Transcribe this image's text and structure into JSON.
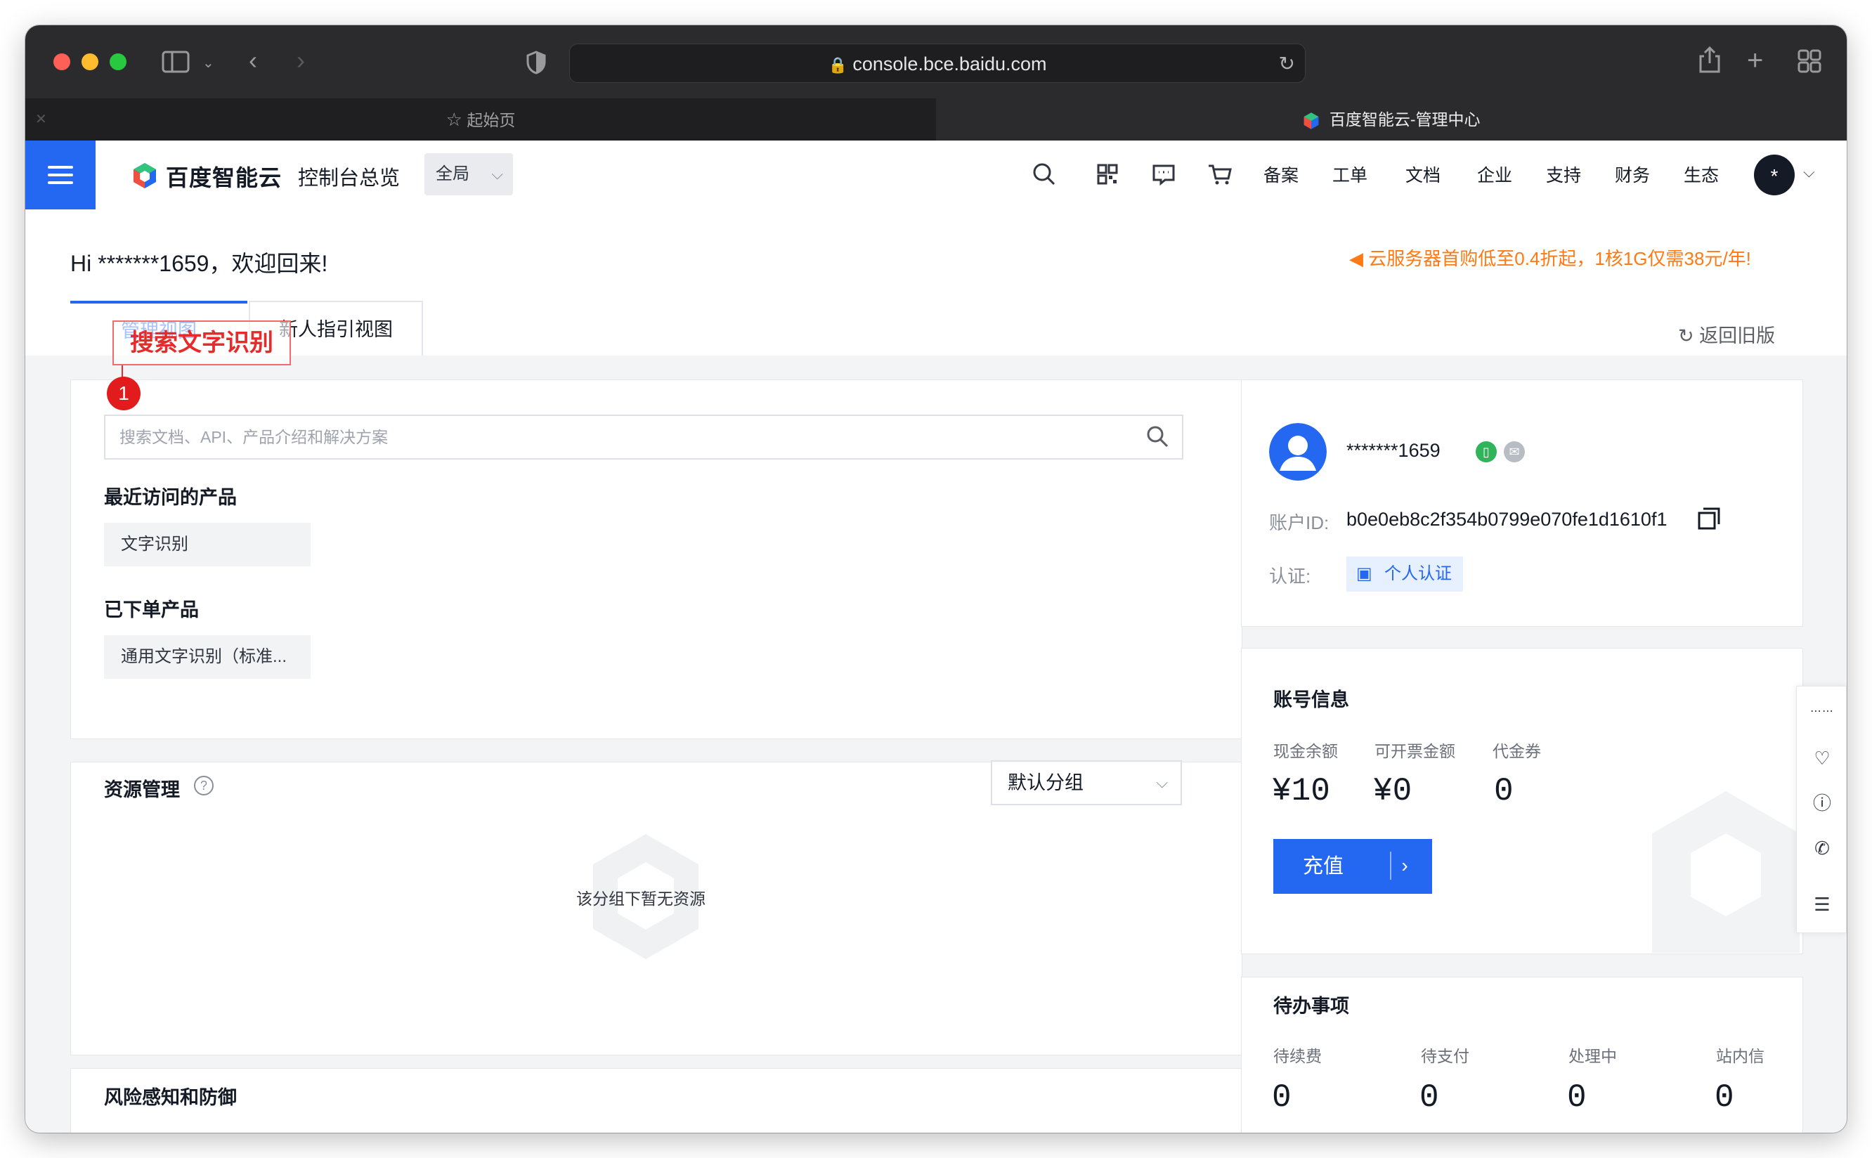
{
  "browser": {
    "url": "console.bce.baidu.com",
    "tabs": [
      {
        "label": "起始页"
      },
      {
        "label": "百度智能云-管理中心"
      }
    ]
  },
  "header": {
    "logo_text": "百度智能云",
    "console_title": "控制台总览",
    "region": "全局",
    "nav": [
      "备案",
      "工单",
      "文档",
      "企业",
      "支持",
      "财务",
      "生态"
    ],
    "avatar_char": "*"
  },
  "welcome": {
    "greeting": "Hi *******1659，欢迎回来!",
    "promo": "云服务器首购低至0.4折起，1核1G仅需38元/年!",
    "view_tabs": [
      "管理视图",
      "新人指引视图"
    ],
    "back_old": "返回旧版"
  },
  "annotation": {
    "label": "搜索文字识别",
    "step": "1"
  },
  "search": {
    "placeholder": "搜索文档、API、产品介绍和解决方案"
  },
  "recent": {
    "title": "最近访问的产品",
    "items": [
      "文字识别"
    ]
  },
  "ordered": {
    "title": "已下单产品",
    "items": [
      "通用文字识别（标准..."
    ]
  },
  "resources": {
    "title": "资源管理",
    "group_select": "默认分组",
    "empty": "该分组下暂无资源"
  },
  "risk": {
    "title": "风险感知和防御"
  },
  "profile": {
    "username": "*******1659",
    "account_id_label": "账户ID:",
    "account_id": "b0e0eb8c2f354b0799e070fe1d1610f1",
    "cert_label": "认证:",
    "cert_value": "个人认证"
  },
  "account": {
    "title": "账号信息",
    "stats": [
      {
        "label": "现金余额",
        "value": "¥10"
      },
      {
        "label": "可开票金额",
        "value": "¥0"
      },
      {
        "label": "代金券",
        "value": "0"
      }
    ],
    "recharge": "充值"
  },
  "todo": {
    "title": "待办事项",
    "stats": [
      {
        "label": "待续费",
        "value": "0"
      },
      {
        "label": "待支付",
        "value": "0"
      },
      {
        "label": "处理中",
        "value": "0"
      },
      {
        "label": "站内信",
        "value": "0"
      }
    ]
  },
  "colors": {
    "brand_blue": "#2468f2",
    "promo_orange": "#ff7a14",
    "annotation_red": "#e72b2b"
  }
}
